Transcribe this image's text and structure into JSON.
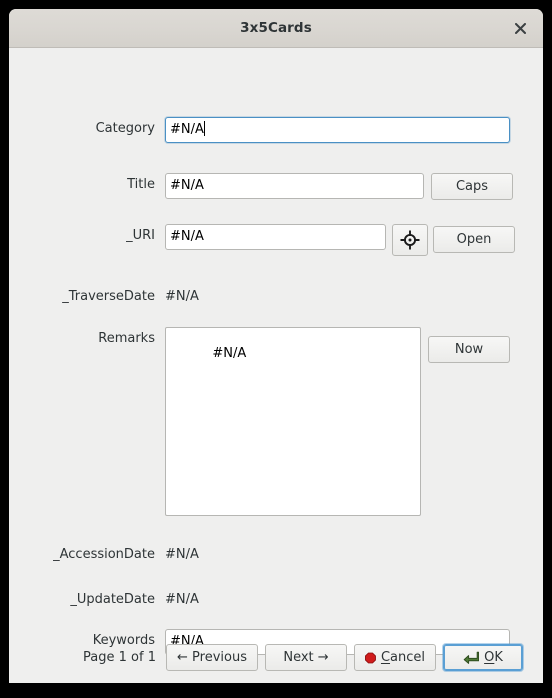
{
  "window": {
    "title": "3x5Cards",
    "close_icon": "close-icon"
  },
  "form": {
    "category": {
      "label": "Category",
      "value": "#N/A",
      "focused": true
    },
    "title": {
      "label": "Title",
      "value": "#N/A",
      "button": "Caps"
    },
    "uri": {
      "label": "_URI",
      "value": "#N/A",
      "icon_button": "crosshair-target-icon",
      "button": "Open"
    },
    "traverse_date": {
      "label": "_TraverseDate",
      "value": "#N/A"
    },
    "remarks": {
      "label": "Remarks",
      "value": "#N/A",
      "button": "Now"
    },
    "accession_date": {
      "label": "_AccessionDate",
      "value": "#N/A"
    },
    "update_date": {
      "label": "_UpdateDate",
      "value": "#N/A"
    },
    "keywords": {
      "label": "Keywords",
      "value": "#N/A"
    }
  },
  "footer": {
    "page_indicator": "Page 1 of 1",
    "previous": "← Previous",
    "next": "Next →",
    "cancel": {
      "label": "Cancel",
      "accelerator": "C",
      "icon": "stop-octagon-icon",
      "icon_color": "#cc0000"
    },
    "ok": {
      "label": "OK",
      "accelerator": "O",
      "icon": "enter-arrow-icon",
      "icon_color": "#4e7a3a",
      "focused": true
    }
  },
  "colors": {
    "window_bg": "#efefee",
    "titlebar_top": "#dedbd6",
    "titlebar_bottom": "#d4d1cb",
    "focus_blue": "#4a90c4",
    "text": "#2e3436",
    "desktop": "#000000"
  }
}
